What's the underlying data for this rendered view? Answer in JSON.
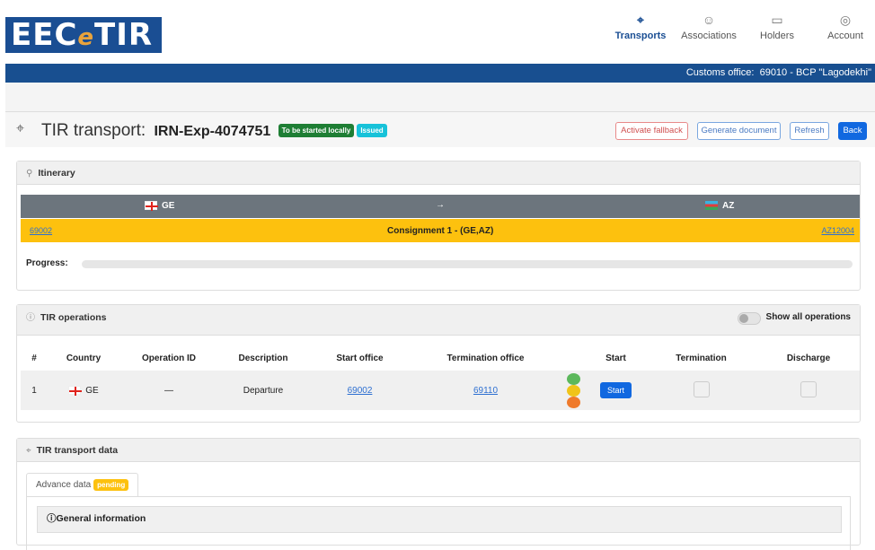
{
  "brand": {
    "logo_pre": "EEC",
    "logo_e": "e",
    "logo_post": "TIR"
  },
  "nav": [
    {
      "label": "Transports",
      "icon": "map-icon",
      "active": true
    },
    {
      "label": "Associations",
      "icon": "users-icon",
      "active": false
    },
    {
      "label": "Holders",
      "icon": "id-card-icon",
      "active": false
    },
    {
      "label": "Account",
      "icon": "account-icon",
      "active": false
    }
  ],
  "customs": {
    "label": "Customs office:",
    "value": "69010 - BCP \"Lagodekhi\""
  },
  "header": {
    "title": "TIR transport:",
    "id": "IRN-Exp-4074751",
    "badges": [
      "To be started locally",
      "Issued"
    ],
    "buttons": {
      "fallback": "Activate fallback",
      "generate": "Generate document",
      "refresh": "Refresh",
      "back": "Back"
    }
  },
  "itinerary": {
    "title": "Itinerary",
    "from": "GE",
    "arrow": "→",
    "to": "AZ",
    "start_code": "69002",
    "consignment": "Consignment 1 - (GE,AZ)",
    "end_code": "AZ12004",
    "progress_label": "Progress:",
    "progress_value": 0
  },
  "operations": {
    "title": "TIR operations",
    "toggle_label": "Show all operations",
    "columns": [
      "#",
      "Country",
      "Operation ID",
      "Description",
      "Start office",
      "Termination office",
      "",
      "Start",
      "Termination",
      "Discharge"
    ],
    "rows": [
      {
        "num": "1",
        "country": "GE",
        "op_id": "—",
        "desc": "Departure",
        "start_office": "69002",
        "term_office": "69110",
        "start_btn": "Start"
      }
    ],
    "light_colors": [
      "#5cb85c",
      "#f0c419",
      "#ef7a2b"
    ]
  },
  "transport_data": {
    "title": "TIR transport data",
    "tab": "Advance data",
    "tab_badge": "pending",
    "general": "General information"
  }
}
